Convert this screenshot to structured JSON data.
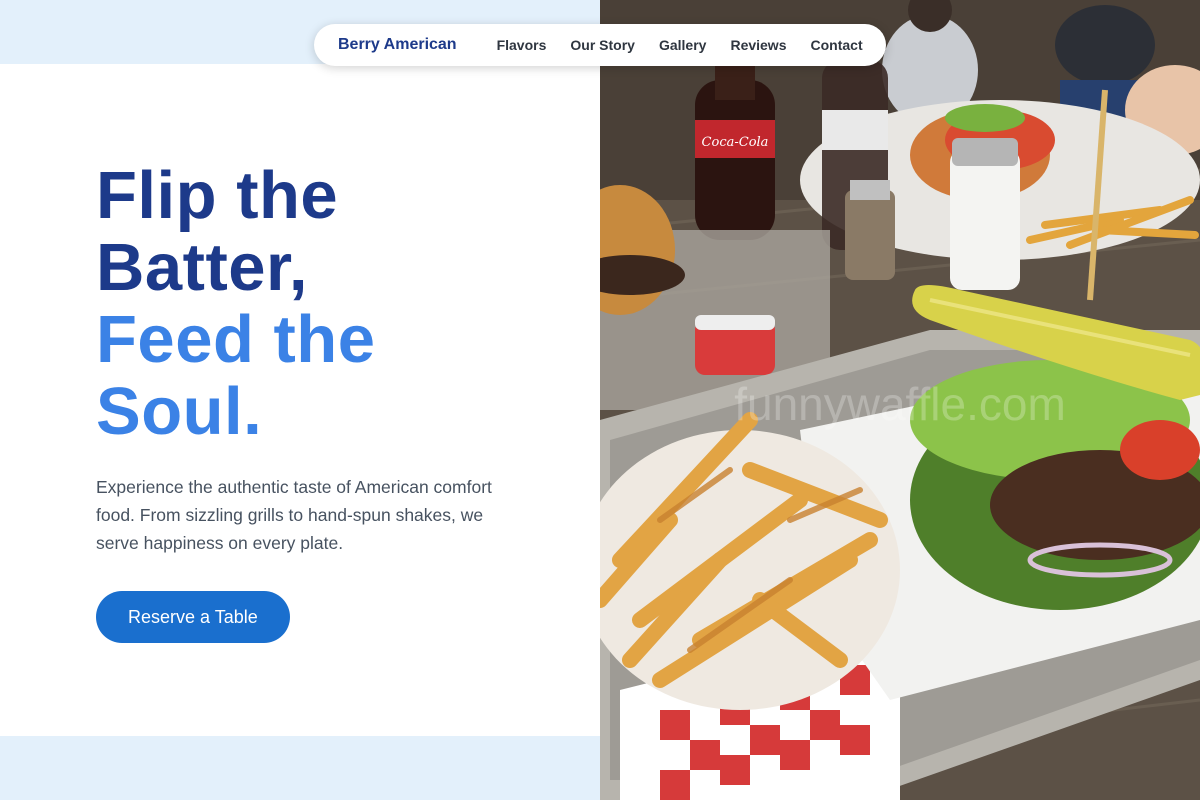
{
  "nav": {
    "brand": "Berry American",
    "links": [
      "Flavors",
      "Our Story",
      "Gallery",
      "Reviews",
      "Contact"
    ]
  },
  "hero": {
    "headline_line1": "Flip the",
    "headline_line2": "Batter,",
    "headline_line3": "Feed the",
    "headline_line4": "Soul.",
    "description": "Experience the authentic taste of American comfort food. From sizzling grills to hand-spun shakes, we serve happiness on every plate.",
    "cta_label": "Reserve a Table"
  },
  "photo": {
    "bottle_label": "Coca-Cola",
    "watermark": "funnywaffle.com"
  },
  "colors": {
    "headline_dark": "#1d3a8a",
    "headline_light": "#3b82e6",
    "cta": "#1a6fce",
    "page_background": "#e3f0fb"
  }
}
